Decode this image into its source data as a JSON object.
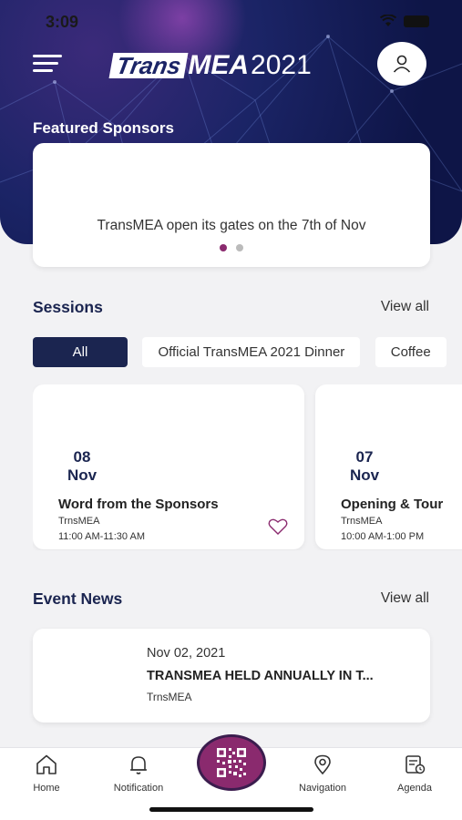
{
  "status_bar": {
    "time": "3:09"
  },
  "header": {
    "logo_part1": "Trans",
    "logo_part2": "MEA",
    "logo_year": "2021"
  },
  "featured": {
    "title": "Featured Sponsors",
    "text": "TransMEA open its gates on the 7th of Nov",
    "dots": 2,
    "active_dot": 0
  },
  "sessions": {
    "title": "Sessions",
    "view_all": "View all",
    "chips": [
      "All",
      "Official TransMEA 2021 Dinner",
      "Coffee"
    ],
    "cards": [
      {
        "day": "08",
        "month": "Nov",
        "title": "Word from the Sponsors",
        "org": "TrnsMEA",
        "time": "11:00 AM-11:30 AM"
      },
      {
        "day": "07",
        "month": "Nov",
        "title": "Opening & Tour",
        "org": "TrnsMEA",
        "time": "10:00 AM-1:00 PM"
      }
    ]
  },
  "news": {
    "title": "Event News",
    "view_all": "View all",
    "item": {
      "date": "Nov 02, 2021",
      "headline": "TRANSMEA HELD ANNUALLY IN T...",
      "org": "TrnsMEA"
    }
  },
  "tabbar": {
    "home": "Home",
    "notification": "Notification",
    "navigation": "Navigation",
    "agenda": "Agenda"
  },
  "colors": {
    "primary": "#1b2550",
    "accent": "#8a2a6e"
  }
}
